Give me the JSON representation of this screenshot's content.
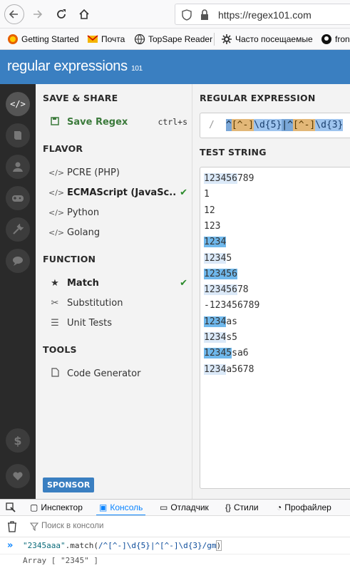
{
  "browser": {
    "url": "https://regex101.com",
    "bookmarks": [
      {
        "label": "Getting Started",
        "icon": "firefox-icon"
      },
      {
        "label": "Почта",
        "icon": "mail-icon"
      },
      {
        "label": "TopSape Reader",
        "icon": "globe-icon"
      },
      {
        "label": "Часто посещаемые",
        "icon": "gear-icon"
      },
      {
        "label": "fron",
        "icon": "github-icon"
      }
    ]
  },
  "app": {
    "logo_main": "regular expressions",
    "logo_sub": "101"
  },
  "menu": {
    "save_share": "SAVE & SHARE",
    "save_regex": "Save Regex",
    "save_shortcut": "ctrl+s",
    "flavor": "FLAVOR",
    "flavors": [
      "PCRE (PHP)",
      "ECMAScript (JavaSc...",
      "Python",
      "Golang"
    ],
    "function": "FUNCTION",
    "functions": [
      "Match",
      "Substitution",
      "Unit Tests"
    ],
    "tools": "TOOLS",
    "code_generator": "Code Generator",
    "sponsor": "SPONSOR"
  },
  "main": {
    "regex_header": "REGULAR EXPRESSION",
    "regex_slash": "/",
    "regex_tokens": [
      "^",
      "[^-]",
      "\\d{5}",
      "|",
      "^",
      "[^-]",
      "\\d{3}"
    ],
    "test_header": "TEST STRING",
    "test_lines": [
      {
        "match": "123456",
        "rest": "789",
        "style": "a"
      },
      {
        "match": "",
        "rest": "1",
        "style": ""
      },
      {
        "match": "",
        "rest": "12",
        "style": ""
      },
      {
        "match": "",
        "rest": "123",
        "style": ""
      },
      {
        "match": "1234",
        "rest": "",
        "style": "b"
      },
      {
        "match": "1234",
        "rest": "5",
        "style": "a"
      },
      {
        "match": "123456",
        "rest": "",
        "style": "b"
      },
      {
        "match": "123456",
        "rest": "78",
        "style": "a"
      },
      {
        "match": "",
        "rest": "-123456789",
        "style": ""
      },
      {
        "match": "1234",
        "rest": "as",
        "style": "b"
      },
      {
        "match": "1234",
        "rest": "s5",
        "style": "a"
      },
      {
        "match": "12345",
        "rest": "sa6",
        "style": "b"
      },
      {
        "match": "1234",
        "rest": "a5678",
        "style": "a"
      }
    ]
  },
  "devtools": {
    "tabs": [
      "Инспектор",
      "Консоль",
      "Отладчик",
      "Стили",
      "Профайлер"
    ],
    "active_tab": "Консоль",
    "filter_placeholder": "Поиск в консоли",
    "input_string": "\"2345aaa\"",
    "input_method": ".match(",
    "input_regex": "/^[^-]\\d{5}|^[^-]\\d{3}/gm",
    "input_close": ")",
    "output": "Array [ \"2345\" ]"
  }
}
